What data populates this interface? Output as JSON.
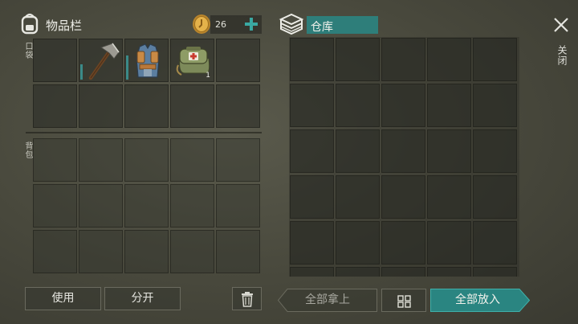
{
  "inventory": {
    "title": "物品栏",
    "icon": "backpack-icon"
  },
  "currency": {
    "amount": "26",
    "coin_icon": "coin-icon",
    "add_icon": "plus-icon"
  },
  "pockets_label": "口袋",
  "backpack_label": "背包",
  "items": [
    {
      "name": "hatchet",
      "icon": "hatchet-icon",
      "count": "",
      "durability": 0.35
    },
    {
      "name": "armor-vest",
      "icon": "armor-vest-icon",
      "count": "",
      "durability": 0.55
    },
    {
      "name": "first-aid-bag",
      "icon": "first-aid-bag-icon",
      "count": "1"
    }
  ],
  "storage": {
    "title": "仓库",
    "icon": "storage-box-icon"
  },
  "close": {
    "label": "关闭",
    "icon": "close-icon"
  },
  "buttons": {
    "use": "使用",
    "split": "分开",
    "trash_icon": "trash-icon",
    "take_all": "全部拿上",
    "sort_icon": "grid-sort-icon",
    "put_all": "全部放入"
  },
  "colors": {
    "accent": "#2e8b87",
    "accent_dark": "#23706c"
  }
}
